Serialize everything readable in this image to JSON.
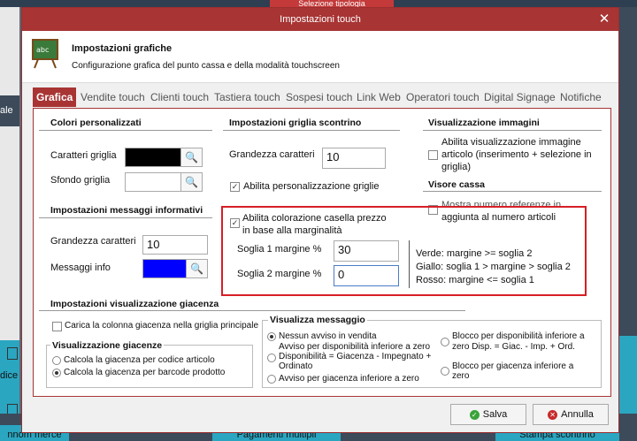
{
  "background": {
    "top_tab": "Selezione tipologia",
    "left_label": "ale",
    "left_tile_1": "dice m",
    "bottom_items": [
      "nnom merce",
      "Pagamenti multipli",
      "Stampa scontrino"
    ]
  },
  "dialog": {
    "title": "Impostazioni touch",
    "header": {
      "title": "Impostazioni grafiche",
      "subtitle": "Configurazione grafica del punto cassa e della modalità touchscreen"
    },
    "tabs": [
      "Grafica",
      "Vendite touch",
      "Clienti touch",
      "Tastiera touch",
      "Sospesi touch",
      "Link Web",
      "Operatori touch",
      "Digital Signage",
      "Notifiche"
    ],
    "colori": {
      "title": "Colori personalizzati",
      "caratteri_griglia": "Caratteri griglia",
      "sfondo_griglia": "Sfondo griglia",
      "caratteri_color": "#000000",
      "sfondo_color": "#ffffff"
    },
    "messaggi": {
      "title": "Impostazioni messaggi informativi",
      "grandezza_label": "Grandezza caratteri",
      "grandezza_value": "10",
      "info_label": "Messaggi info",
      "info_color": "#0000ff"
    },
    "griglia": {
      "title": "Impostazioni griglia scontrino",
      "grandezza_label": "Grandezza caratteri",
      "grandezza_value": "10",
      "abilita_label": "Abilita personalizzazione griglie"
    },
    "immagini": {
      "title": "Visualizzazione immagini",
      "abilita_line1": "Abilita visualizzazione immagine",
      "abilita_line2": "articolo (inserimento + selezione in",
      "abilita_line3": "griglia)"
    },
    "visore": {
      "title": "Visore cassa",
      "line1": "Mostra numero referenze in",
      "line2": "aggiunta al numero articoli"
    },
    "marginalita": {
      "check_line1": "Abilita colorazione casella prezzo",
      "check_line2": "in base alla marginalità",
      "soglia1_label": "Soglia 1 margine %",
      "soglia1_value": "30",
      "soglia2_label": "Soglia 2 margine %",
      "soglia2_value": "0",
      "legend_verde": "Verde: margine >= soglia 2",
      "legend_giallo": "Giallo: soglia 1 > margine > soglia 2",
      "legend_rosso": "Rosso: margine <= soglia 1"
    },
    "giacenza": {
      "title": "Impostazioni visualizzazione giacenza",
      "carica_label": "Carica la colonna giacenza nella griglia principale",
      "vis_title": "Visualizzazione giacenze",
      "opt_codice": "Calcola la giacenza per codice articolo",
      "opt_barcode": "Calcola la giacenza per barcode prodotto",
      "msg_title": "Visualizza messaggio",
      "msg_opt1": "Nessun avviso in vendita",
      "msg_opt2_line1": "Avviso per disponibilità inferiore a zero",
      "msg_opt2_line2": "Disponibilità = Giacenza - Impegnato +",
      "msg_opt2_line3": "Ordinato",
      "msg_opt3": "Avviso per giacenza inferiore a zero",
      "msg_opt4_line1": "Blocco per disponibilità inferiore a",
      "msg_opt4_line2": "zero Disp. = Giac. - Imp. + Ord.",
      "msg_opt5_line1": "Blocco per giacenza inferiore a",
      "msg_opt5_line2": "zero"
    },
    "buttons": {
      "salva": "Salva",
      "annulla": "Annulla"
    }
  }
}
